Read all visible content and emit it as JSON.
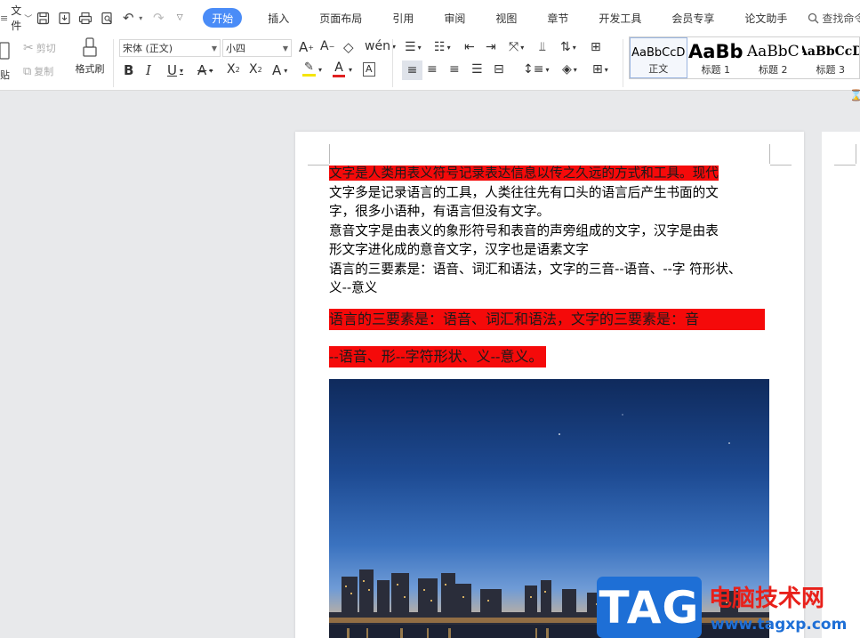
{
  "menubar": {
    "file_label": "文件",
    "tabs": [
      {
        "label": "开始",
        "active": true
      },
      {
        "label": "插入"
      },
      {
        "label": "页面布局"
      },
      {
        "label": "引用"
      },
      {
        "label": "审阅"
      },
      {
        "label": "视图"
      },
      {
        "label": "章节"
      },
      {
        "label": "开发工具"
      },
      {
        "label": "会员专享"
      },
      {
        "label": "论文助手"
      }
    ],
    "search_placeholder": "查找命令、搜索"
  },
  "ribbon": {
    "cut_label": "剪切",
    "paste_label": "贴",
    "copy_label": "复制",
    "format_painter_label": "格式刷",
    "font_name": "宋体 (正文)",
    "font_size": "小四",
    "bold": "B",
    "italic": "I",
    "underline": "U",
    "font_color_letter": "A",
    "styles": [
      {
        "preview": "AaBbCcD",
        "name": "正文"
      },
      {
        "preview": "AaBb",
        "name": "标题 1"
      },
      {
        "preview": "AaBbC",
        "name": "标题 2"
      },
      {
        "preview": "AaBbCcD",
        "name": "标题 3"
      }
    ],
    "colors": {
      "accent": "#4a8cf7",
      "highlight": "#f5e500",
      "font_color": "#e02020"
    }
  },
  "document": {
    "lines": [
      {
        "text": "文字是人类用表义符号记录表达信息以传之久远的方式和工具。现代",
        "highlight": true
      },
      {
        "text": "文字多是记录语言的工具，人类往往先有口头的语言后产生书面的文"
      },
      {
        "text": "字，很多小语种，有语言但没有文字。"
      },
      {
        "text": "意音文字是由表义的象形符号和表音的声旁组成的文字，汉字是由表"
      },
      {
        "text": "形文字进化成的意音文字，汉字也是语素文字"
      },
      {
        "text": "语言的三要素是：语音、词汇和语法，文字的三音--语音、--字  符形状、"
      },
      {
        "text": "义--意义"
      }
    ],
    "highlighted_paragraph": [
      "语言的三要素是：语音、词汇和语法，文字的三要素是：音",
      "--语音、形--字符形状、义--意义。"
    ],
    "highlight_color": "#f50a0a"
  },
  "watermark": {
    "tag": "TAG",
    "site_name": "电脑技术网",
    "url": "www.tagxp.com"
  }
}
